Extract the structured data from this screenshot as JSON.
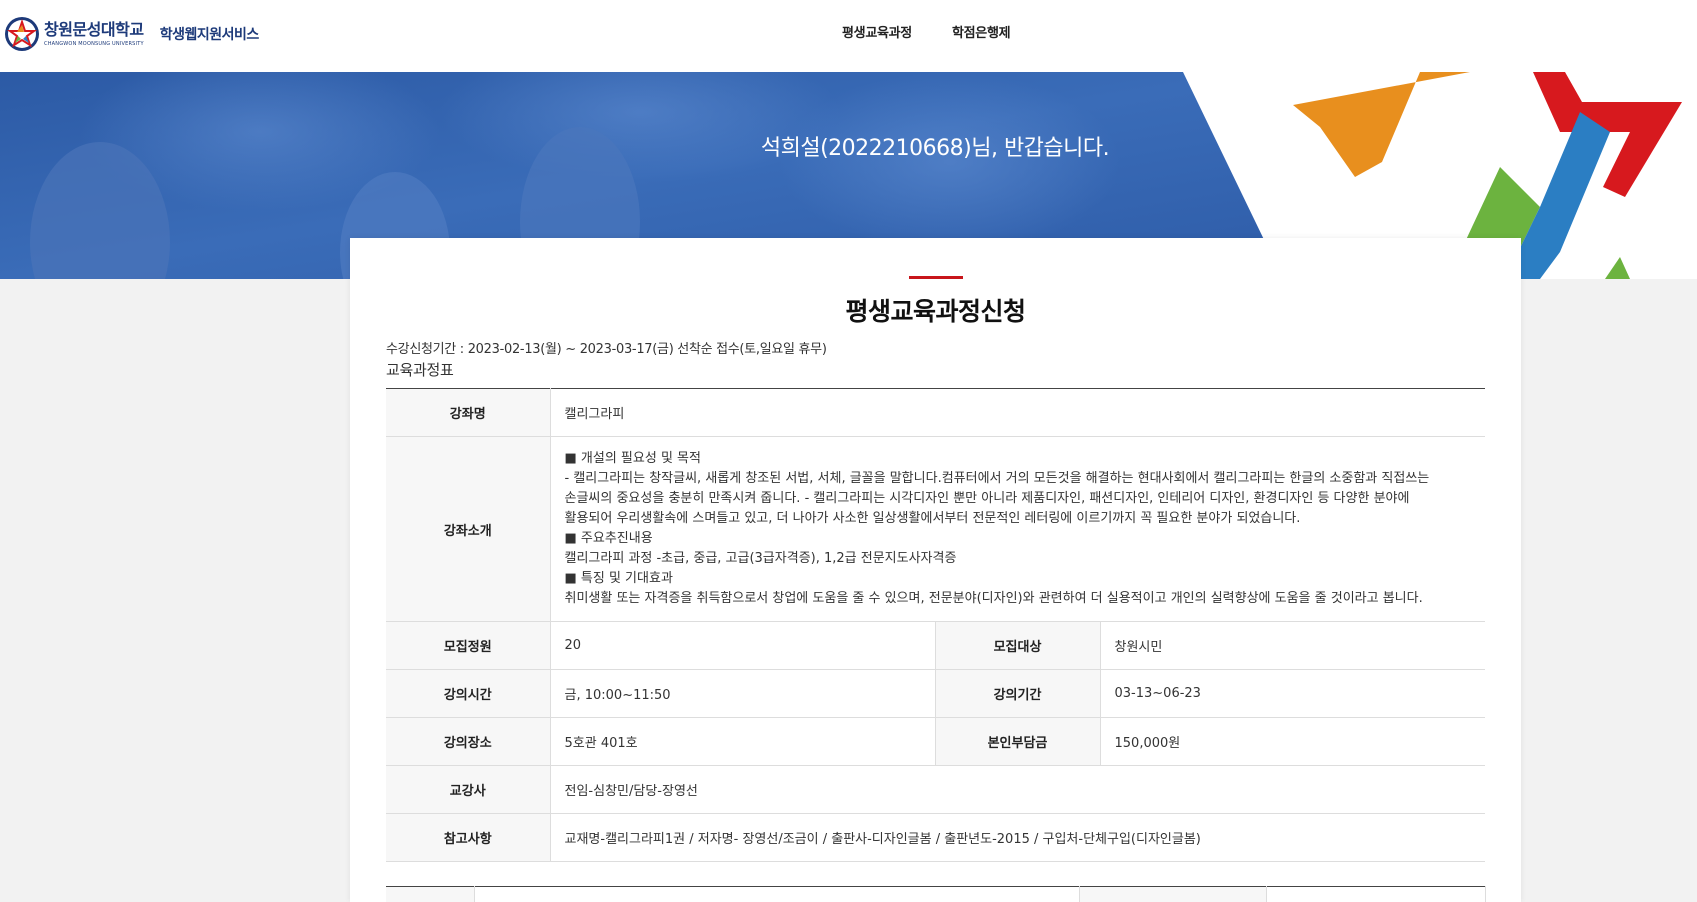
{
  "header": {
    "university_name": "창원문성대학교",
    "university_name_en": "CHANGWON MOONSUNG UNIVERSITY",
    "service_name": "학생웹지원서비스",
    "nav": [
      "평생교육과정",
      "학점은행제"
    ]
  },
  "banner": {
    "welcome": "석희설(2022210668)님, 반갑습니다."
  },
  "main": {
    "title": "평생교육과정신청",
    "period": "수강신청기간 : 2023-02-13(월) ~ 2023-03-17(금) 선착순 접수(토,일요일 휴무)",
    "subheading": "교육과정표",
    "course": {
      "name_label": "강좌명",
      "name": "캘리그라피",
      "intro_label": "강좌소개",
      "intro_lines": [
        "■ 개설의 필요성 및 목적",
        "- 캘리그라피는 창작글씨, 새롭게 창조된 서법, 서체, 글꼴을 말합니다.컴퓨터에서 거의 모든것을 해결하는 현대사회에서 캘리그라피는 한글의 소중함과 직접쓰는",
        "손글씨의 중요성을 충분히 만족시켜 줍니다. - 캘리그라피는 시각디자인 뿐만 아니라 제품디자인, 패션디자인, 인테리어 디자인, 환경디자인 등 다양한 분야에",
        "활용되어 우리생활속에 스며들고 있고, 더 나아가 사소한 일상생활에서부터 전문적인 레터링에 이르기까지 꼭 필요한 분야가 되었습니다.",
        "■ 주요추진내용",
        "캘리그라피 과정 -초급, 중급, 고급(3급자격증), 1,2급 전문지도사자격증",
        "■ 특징 및 기대효과",
        "취미생활 또는 자격증을 취득함으로서 창업에 도움을 줄 수 있으며, 전문분야(디자인)와 관련하여 더 실용적이고 개인의 실력향상에 도움을 줄 것이라고 봅니다."
      ],
      "capacity_label": "모집정원",
      "capacity": "20",
      "target_label": "모집대상",
      "target": "창원시민",
      "time_label": "강의시간",
      "time": "금, 10:00~11:50",
      "duration_label": "강의기간",
      "duration": "03-13~06-23",
      "place_label": "강의장소",
      "place": "5호관 401호",
      "fee_label": "본인부담금",
      "fee": "150,000원",
      "instructor_label": "교강사",
      "instructor": "전임-심창민/담당-장영선",
      "note_label": "참고사항",
      "note": "교재명-캘리그라피1권 / 저자명- 장영선/조금이 / 출판사-디자인글봄 / 출판년도-2015 / 구입처-단체구입(디자인글봄)"
    }
  },
  "colors": {
    "brand_navy": "#1d3a7a",
    "accent_red": "#c8151b",
    "banner_blue": "#2f5fae",
    "emblem_orange": "#e88f1e",
    "emblem_red": "#d7191e",
    "emblem_green": "#6cb33f",
    "emblem_blue": "#2b7ec3"
  }
}
